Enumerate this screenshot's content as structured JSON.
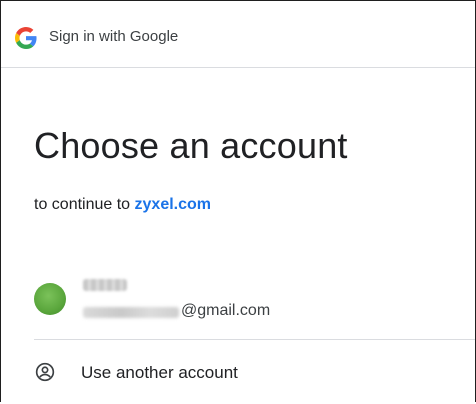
{
  "header": {
    "title": "Sign in with Google",
    "logo_icon": "google-g-icon"
  },
  "main": {
    "heading": "Choose an account",
    "subtitle_prefix": "to continue to",
    "site": "zyxel.com"
  },
  "account": {
    "email_suffix": "@gmail.com",
    "avatar_color": "#5aa63c"
  },
  "other_account": {
    "label": "Use another account",
    "icon": "person-circle-icon"
  },
  "colors": {
    "link": "#1a73e8",
    "divider": "#dadce0"
  }
}
